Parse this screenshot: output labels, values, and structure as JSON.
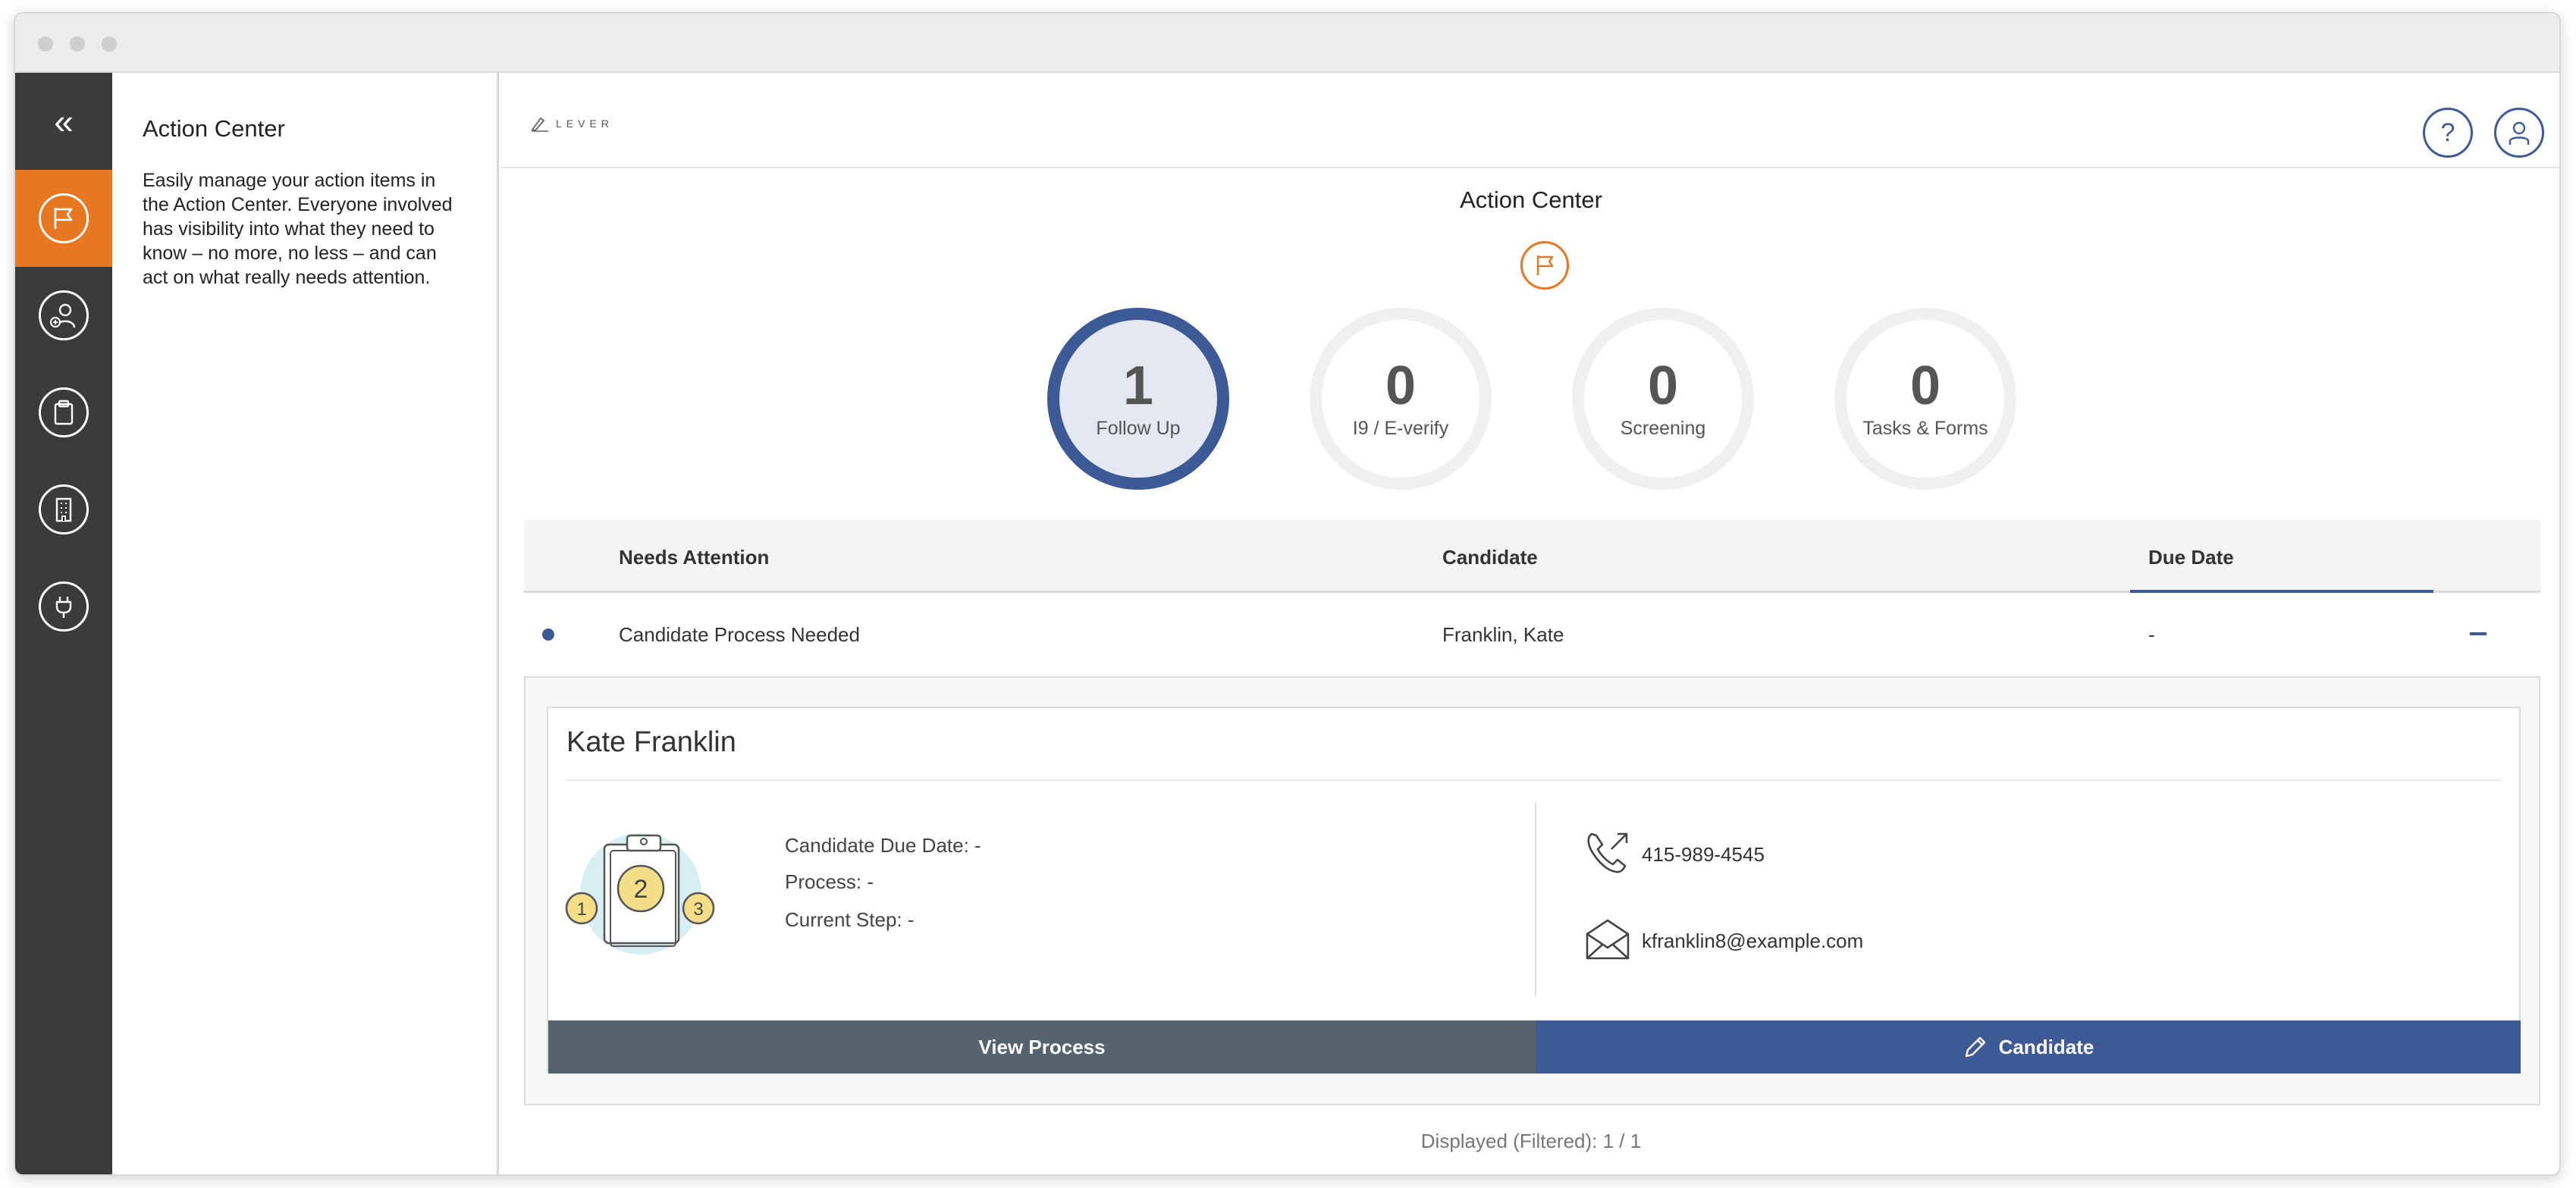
{
  "nav": {
    "collapse_glyph": "«"
  },
  "side_panel": {
    "title": "Action Center",
    "description": "Easily manage your action items in the Action Center. Everyone involved has visibility into what they need to know – no more, no less – and can act on what really needs attention."
  },
  "header": {
    "logo_text": "LEVER",
    "help_label": "?"
  },
  "main": {
    "title": "Action Center",
    "categories": [
      {
        "count": "1",
        "label": "Follow Up"
      },
      {
        "count": "0",
        "label": "I9 / E-verify"
      },
      {
        "count": "0",
        "label": "Screening"
      },
      {
        "count": "0",
        "label": "Tasks & Forms"
      }
    ]
  },
  "table": {
    "headers": {
      "needs_attention": "Needs Attention",
      "candidate": "Candidate",
      "due_date": "Due Date"
    },
    "row": {
      "needs_attention": "Candidate Process Needed",
      "candidate": "Franklin, Kate",
      "due_date": "-"
    }
  },
  "detail": {
    "name": "Kate Franklin",
    "due_date": "Candidate Due Date: -",
    "process": "Process: -",
    "current_step": "Current Step: -",
    "phone": "415-989-4545",
    "email": "kfranklin8@example.com",
    "illustration_steps": [
      "1",
      "2",
      "3"
    ],
    "view_process_label": "View Process",
    "candidate_label": "Candidate"
  },
  "footer": {
    "count_text": "Displayed (Filtered): 1 / 1"
  },
  "colors": {
    "accent_orange": "#e87722",
    "primary_blue": "#3d5a96",
    "slate_button": "#55636f",
    "nav_dark": "#3b3b3b"
  }
}
